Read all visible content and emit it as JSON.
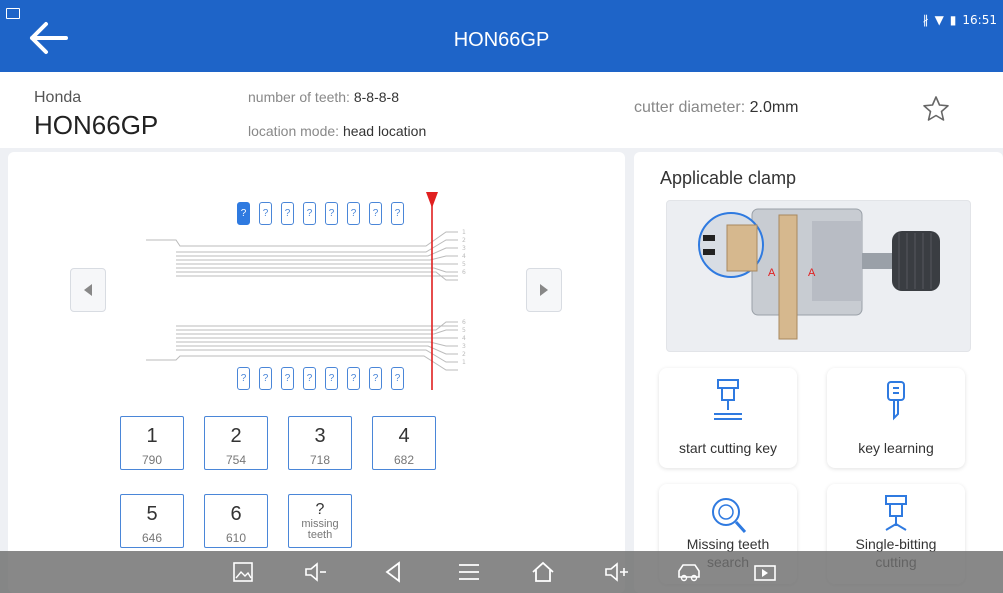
{
  "status_bar": {
    "time": "16:51",
    "icons": [
      "gallery-icon",
      "bluetooth-icon",
      "wifi-icon",
      "battery-icon"
    ]
  },
  "header": {
    "title": "HON66GP",
    "back_icon": "back-arrow-icon"
  },
  "key_info": {
    "brand": "Honda",
    "model": "HON66GP",
    "teeth_label": "number of teeth:",
    "teeth_value": "8-8-8-8",
    "location_label": "location mode:",
    "location_value": "head location",
    "cutter_label": "cutter diameter:",
    "cutter_value": "2.0mm",
    "favorite_icon": "star-icon"
  },
  "tooth_placeholder": "?",
  "depths": [
    {
      "num": "1",
      "value": "790"
    },
    {
      "num": "2",
      "value": "754"
    },
    {
      "num": "3",
      "value": "718"
    },
    {
      "num": "4",
      "value": "682"
    },
    {
      "num": "5",
      "value": "646"
    },
    {
      "num": "6",
      "value": "610"
    }
  ],
  "missing": {
    "num": "?",
    "label": "missing",
    "label2": "teeth"
  },
  "clamp": {
    "title": "Applicable clamp",
    "mark": "A"
  },
  "functions": {
    "start_cutting": "start cutting key",
    "key_learning": "key learning",
    "missing_line1": "Missing teeth",
    "missing_line2": "search",
    "single_line1": "Single-bitting",
    "single_line2": "cutting"
  },
  "colors": {
    "header": "#1e64c8",
    "accent": "#2f7ae0",
    "cut_line": "#e02020"
  }
}
